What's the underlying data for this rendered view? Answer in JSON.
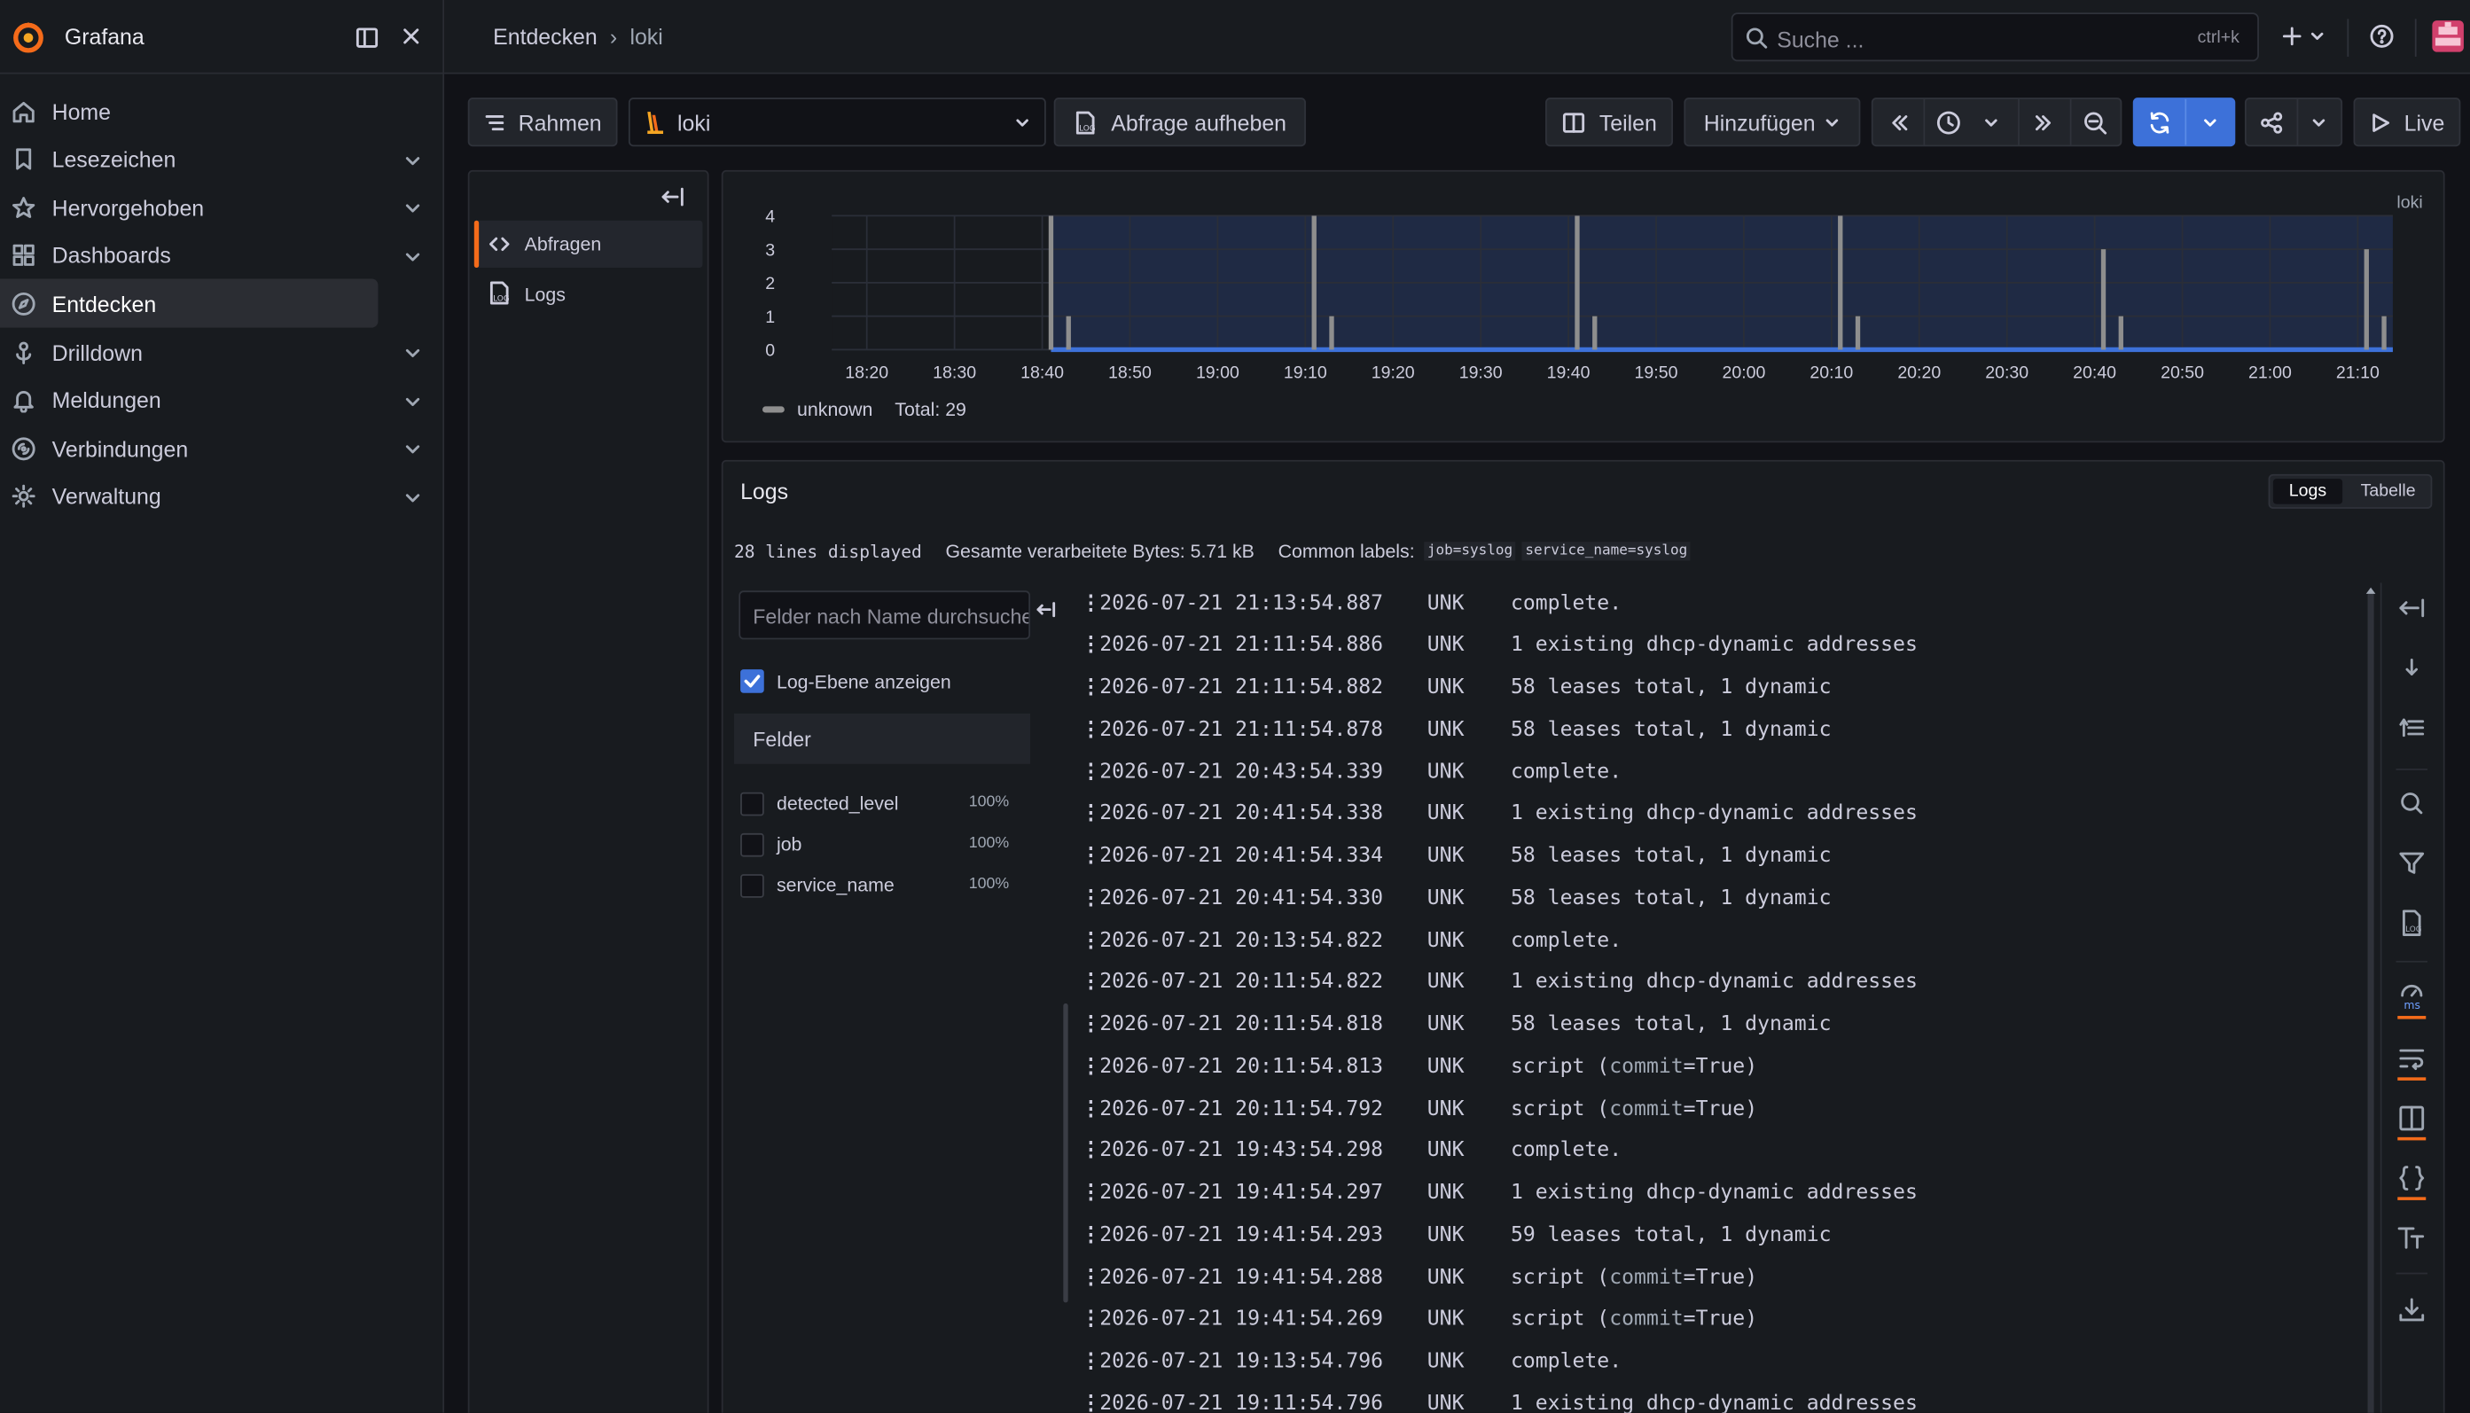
{
  "app": {
    "name": "Grafana"
  },
  "sidebar": {
    "items": [
      {
        "label": "Home",
        "icon": "home-icon",
        "chevron": false
      },
      {
        "label": "Lesezeichen",
        "icon": "bookmark-icon",
        "chevron": true
      },
      {
        "label": "Hervorgehoben",
        "icon": "star-icon",
        "chevron": true
      },
      {
        "label": "Dashboards",
        "icon": "dashboards-icon",
        "chevron": true
      },
      {
        "label": "Entdecken",
        "icon": "compass-icon",
        "chevron": false,
        "active": true
      },
      {
        "label": "Drilldown",
        "icon": "drilldown-icon",
        "chevron": true
      },
      {
        "label": "Meldungen",
        "icon": "bell-icon",
        "chevron": true
      },
      {
        "label": "Verbindungen",
        "icon": "connections-icon",
        "chevron": true
      },
      {
        "label": "Verwaltung",
        "icon": "gear-icon",
        "chevron": true
      }
    ]
  },
  "breadcrumb": {
    "first": "Entdecken",
    "sep": "›",
    "second": "loki"
  },
  "search": {
    "placeholder": "Suche ...",
    "shortcut": "ctrl+k"
  },
  "toolbar": {
    "rahmen": "Rahmen",
    "datasource": "loki",
    "abfrage_aufheben": "Abfrage aufheben",
    "teilen": "Teilen",
    "hinzufuegen": "Hinzufügen",
    "live": "Live"
  },
  "queries_panel": {
    "items": [
      {
        "label": "Abfragen"
      },
      {
        "label": "Logs"
      }
    ]
  },
  "chart_data": {
    "type": "bar",
    "series": [
      {
        "name": "unknown",
        "color": "#8e8e8e",
        "times": [
          "18:41",
          "18:43",
          "19:11",
          "19:13",
          "19:41",
          "19:43",
          "20:11",
          "20:13",
          "20:41",
          "20:43",
          "21:11",
          "21:13"
        ],
        "values": [
          4,
          1,
          4,
          1,
          4,
          1,
          4,
          1,
          3,
          1,
          3,
          1
        ]
      }
    ],
    "xticks": [
      "18:20",
      "18:30",
      "18:40",
      "18:50",
      "19:00",
      "19:10",
      "19:20",
      "19:30",
      "19:40",
      "19:50",
      "20:00",
      "20:10",
      "20:20",
      "20:30",
      "20:40",
      "20:50",
      "21:00",
      "21:10"
    ],
    "yticks": [
      "4",
      "3",
      "2",
      "1",
      "0"
    ],
    "ylim": [
      0,
      4
    ],
    "xlim": [
      "18:16",
      "21:14"
    ],
    "legend": {
      "label": "unknown",
      "total": "Total: 29"
    },
    "corner_label": "loki",
    "grid": true
  },
  "logs": {
    "title": "Logs",
    "view_toggle": [
      "Logs",
      "Tabelle"
    ],
    "stats": {
      "lines": "28 lines displayed",
      "bytes": "Gesamte verarbeitete Bytes: 5.71 kB",
      "common": "Common labels:",
      "label1": "job=syslog",
      "label2": "service_name=syslog"
    },
    "field_search_placeholder": "Felder nach Name durchsuchen",
    "show_level_label": "Log-Ebene anzeigen",
    "fields_header": "Felder",
    "fields": [
      {
        "name": "detected_level",
        "pct": "100%"
      },
      {
        "name": "job",
        "pct": "100%"
      },
      {
        "name": "service_name",
        "pct": "100%"
      }
    ],
    "rows": [
      {
        "ts": "2026-07-21 21:13:54.887",
        "lvl": "UNK",
        "msg": "complete."
      },
      {
        "ts": "2026-07-21 21:11:54.886",
        "lvl": "UNK",
        "msg": "1 existing dhcp-dynamic addresses"
      },
      {
        "ts": "2026-07-21 21:11:54.882",
        "lvl": "UNK",
        "msg": "58 leases total, 1 dynamic"
      },
      {
        "ts": "2026-07-21 21:11:54.878",
        "lvl": "UNK",
        "msg": "58 leases total, 1 dynamic"
      },
      {
        "ts": "2026-07-21 20:43:54.339",
        "lvl": "UNK",
        "msg": "complete."
      },
      {
        "ts": "2026-07-21 20:41:54.338",
        "lvl": "UNK",
        "msg": "1 existing dhcp-dynamic addresses"
      },
      {
        "ts": "2026-07-21 20:41:54.334",
        "lvl": "UNK",
        "msg": "58 leases total, 1 dynamic"
      },
      {
        "ts": "2026-07-21 20:41:54.330",
        "lvl": "UNK",
        "msg": "58 leases total, 1 dynamic"
      },
      {
        "ts": "2026-07-21 20:13:54.822",
        "lvl": "UNK",
        "msg": "complete."
      },
      {
        "ts": "2026-07-21 20:11:54.822",
        "lvl": "UNK",
        "msg": "1 existing dhcp-dynamic addresses"
      },
      {
        "ts": "2026-07-21 20:11:54.818",
        "lvl": "UNK",
        "msg": "58 leases total, 1 dynamic"
      },
      {
        "ts": "2026-07-21 20:11:54.813",
        "lvl": "UNK",
        "msg": "script (commit=True)"
      },
      {
        "ts": "2026-07-21 20:11:54.792",
        "lvl": "UNK",
        "msg": "script (commit=True)"
      },
      {
        "ts": "2026-07-21 19:43:54.298",
        "lvl": "UNK",
        "msg": "complete."
      },
      {
        "ts": "2026-07-21 19:41:54.297",
        "lvl": "UNK",
        "msg": "1 existing dhcp-dynamic addresses"
      },
      {
        "ts": "2026-07-21 19:41:54.293",
        "lvl": "UNK",
        "msg": "59 leases total, 1 dynamic"
      },
      {
        "ts": "2026-07-21 19:41:54.288",
        "lvl": "UNK",
        "msg": "script (commit=True)"
      },
      {
        "ts": "2026-07-21 19:41:54.269",
        "lvl": "UNK",
        "msg": "script (commit=True)"
      },
      {
        "ts": "2026-07-21 19:13:54.796",
        "lvl": "UNK",
        "msg": "complete."
      },
      {
        "ts": "2026-07-21 19:11:54.796",
        "lvl": "UNK",
        "msg": "1 existing dhcp-dynamic addresses"
      }
    ]
  },
  "colors": {
    "accent": "#f46b1a",
    "primary": "#3d71d9",
    "bg": "#111217",
    "panel": "#181b1f"
  }
}
